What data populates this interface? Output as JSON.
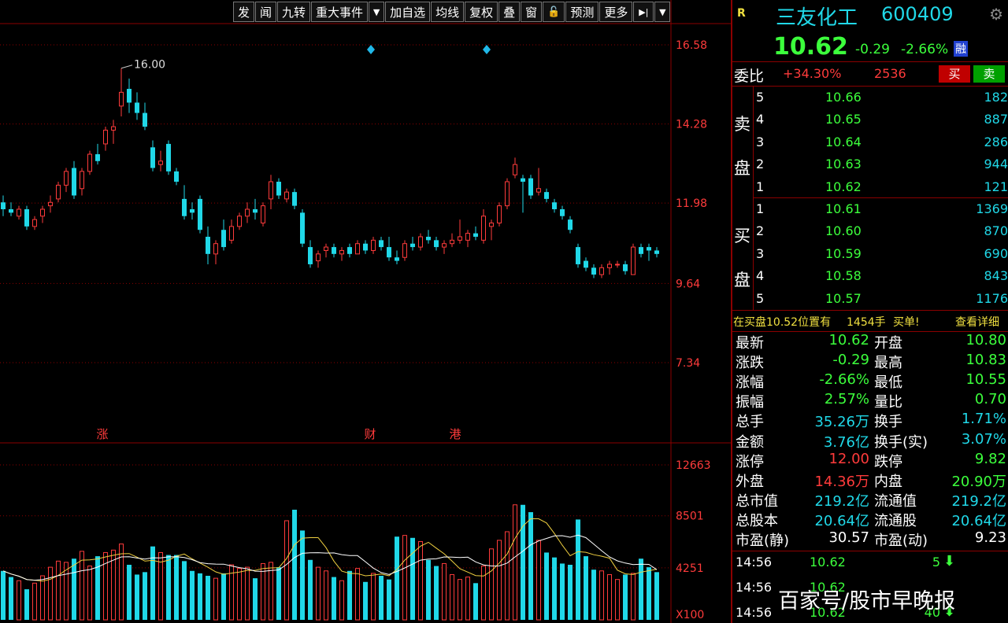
{
  "toolbar": {
    "buttons": [
      "发",
      "闻",
      "九转",
      "重大事件",
      "加自选",
      "均线",
      "复权",
      "叠",
      "窗",
      "预测",
      "更多"
    ]
  },
  "chart_data": {
    "type": "candlestick",
    "price_ticks": [
      "16.58",
      "14.28",
      "11.98",
      "9.64",
      "7.34"
    ],
    "volume_ticks": [
      "12663",
      "8501",
      "4251",
      "X100"
    ],
    "max_label": "16.00",
    "event_markers": [
      "涨",
      "财",
      "港"
    ],
    "colors": {
      "up": "#ff3b3b",
      "down": "#20d8e8",
      "grid": "#8b0000"
    },
    "candles": [
      [
        12.0,
        12.2,
        11.6,
        11.8
      ],
      [
        11.8,
        12.0,
        11.6,
        11.7
      ],
      [
        11.6,
        11.9,
        11.5,
        11.8
      ],
      [
        11.8,
        11.9,
        11.2,
        11.3
      ],
      [
        11.3,
        11.6,
        11.2,
        11.5
      ],
      [
        11.6,
        11.9,
        11.4,
        11.8
      ],
      [
        11.9,
        12.2,
        11.7,
        12.0
      ],
      [
        12.1,
        12.6,
        12.0,
        12.5
      ],
      [
        12.5,
        13.0,
        12.3,
        12.9
      ],
      [
        13.0,
        13.2,
        12.1,
        12.2
      ],
      [
        12.4,
        13.0,
        12.2,
        12.9
      ],
      [
        12.9,
        13.5,
        12.8,
        13.4
      ],
      [
        13.4,
        13.7,
        13.1,
        13.2
      ],
      [
        13.7,
        14.2,
        13.5,
        14.1
      ],
      [
        14.1,
        14.4,
        13.7,
        14.2
      ],
      [
        14.8,
        15.9,
        14.5,
        15.2
      ],
      [
        15.3,
        15.6,
        14.6,
        14.9
      ],
      [
        14.9,
        15.2,
        14.4,
        14.6
      ],
      [
        14.6,
        14.9,
        14.1,
        14.2
      ],
      [
        13.6,
        13.8,
        12.9,
        13.0
      ],
      [
        13.1,
        13.5,
        12.9,
        13.2
      ],
      [
        13.7,
        13.8,
        12.8,
        12.9
      ],
      [
        12.9,
        13.0,
        12.5,
        12.6
      ],
      [
        12.1,
        12.5,
        11.5,
        11.6
      ],
      [
        11.8,
        12.0,
        11.5,
        11.7
      ],
      [
        12.1,
        12.2,
        11.1,
        11.2
      ],
      [
        11.0,
        11.3,
        10.2,
        10.5
      ],
      [
        10.5,
        10.9,
        10.2,
        10.8
      ],
      [
        11.2,
        11.5,
        10.6,
        10.7
      ],
      [
        10.9,
        11.5,
        10.8,
        11.3
      ],
      [
        11.3,
        11.7,
        11.2,
        11.6
      ],
      [
        11.6,
        12.0,
        11.4,
        11.8
      ],
      [
        11.8,
        12.1,
        11.5,
        11.7
      ],
      [
        11.4,
        12.0,
        11.3,
        11.9
      ],
      [
        12.1,
        12.8,
        11.8,
        12.6
      ],
      [
        12.6,
        12.7,
        12.1,
        12.2
      ],
      [
        12.1,
        12.4,
        12.0,
        12.3
      ],
      [
        12.3,
        12.4,
        11.8,
        11.9
      ],
      [
        11.7,
        11.8,
        10.7,
        10.8
      ],
      [
        10.7,
        10.9,
        10.1,
        10.2
      ],
      [
        10.3,
        10.6,
        10.1,
        10.5
      ],
      [
        10.6,
        10.8,
        10.4,
        10.7
      ],
      [
        10.7,
        10.8,
        10.4,
        10.5
      ],
      [
        10.5,
        10.7,
        10.3,
        10.6
      ],
      [
        10.7,
        10.8,
        10.4,
        10.5
      ],
      [
        10.5,
        10.9,
        10.5,
        10.8
      ],
      [
        10.8,
        10.9,
        10.5,
        10.6
      ],
      [
        10.6,
        11.0,
        10.5,
        10.9
      ],
      [
        10.9,
        11.0,
        10.6,
        10.7
      ],
      [
        10.7,
        11.0,
        10.3,
        10.4
      ],
      [
        10.4,
        10.6,
        10.2,
        10.3
      ],
      [
        10.4,
        10.9,
        10.3,
        10.8
      ],
      [
        10.8,
        11.0,
        10.6,
        10.7
      ],
      [
        10.7,
        11.1,
        10.6,
        11.0
      ],
      [
        11.0,
        11.2,
        10.8,
        10.9
      ],
      [
        10.9,
        11.0,
        10.6,
        10.7
      ],
      [
        10.7,
        10.9,
        10.5,
        10.8
      ],
      [
        10.8,
        11.1,
        10.7,
        10.9
      ],
      [
        10.9,
        11.5,
        10.8,
        11.0
      ],
      [
        10.9,
        11.2,
        10.7,
        11.1
      ],
      [
        11.1,
        11.3,
        10.9,
        11.0
      ],
      [
        10.9,
        11.8,
        10.8,
        11.6
      ],
      [
        11.3,
        11.5,
        10.9,
        11.4
      ],
      [
        11.4,
        12.0,
        11.3,
        11.9
      ],
      [
        11.9,
        12.7,
        11.8,
        12.6
      ],
      [
        12.8,
        13.3,
        12.7,
        13.1
      ],
      [
        12.7,
        12.8,
        11.7,
        12.6
      ],
      [
        12.7,
        12.8,
        12.1,
        12.2
      ],
      [
        12.3,
        13.0,
        12.2,
        12.4
      ],
      [
        12.3,
        12.4,
        12.0,
        12.1
      ],
      [
        12.0,
        12.1,
        11.7,
        11.8
      ],
      [
        11.8,
        11.9,
        11.5,
        11.6
      ],
      [
        11.5,
        11.6,
        11.1,
        11.2
      ],
      [
        10.7,
        10.8,
        10.1,
        10.2
      ],
      [
        10.3,
        10.4,
        10.0,
        10.1
      ],
      [
        10.1,
        10.2,
        9.8,
        9.9
      ],
      [
        9.9,
        10.2,
        9.8,
        10.1
      ],
      [
        10.1,
        10.3,
        9.9,
        10.2
      ],
      [
        10.2,
        10.3,
        10.1,
        10.2
      ],
      [
        10.2,
        10.3,
        9.9,
        10.0
      ],
      [
        9.9,
        10.8,
        9.9,
        10.7
      ],
      [
        10.7,
        10.8,
        10.4,
        10.5
      ],
      [
        10.7,
        10.8,
        10.3,
        10.6
      ],
      [
        10.6,
        10.7,
        10.4,
        10.5
      ]
    ],
    "volume_hundred_shares": [
      4000,
      3500,
      3200,
      2500,
      3000,
      3600,
      4300,
      4800,
      4700,
      5000,
      5600,
      4400,
      5200,
      5500,
      5700,
      6200,
      4500,
      3700,
      3900,
      6000,
      5500,
      5300,
      5300,
      4800,
      4000,
      3800,
      3600,
      3400,
      3800,
      4500,
      4200,
      4300,
      3400,
      4600,
      4700,
      4300,
      8100,
      9000,
      7300,
      4900,
      4300,
      4000,
      3500,
      3200,
      4000,
      4200,
      3100,
      3800,
      3600,
      3300,
      6800,
      6900,
      6700,
      6400,
      4900,
      4400,
      4600,
      3700,
      3300,
      3500,
      3000,
      4400,
      5800,
      6500,
      7200,
      9400,
      9400,
      8800,
      6500,
      5500,
      5100,
      4600,
      4500,
      8200,
      5200,
      4100,
      4000,
      3700,
      3300,
      3700,
      3800,
      5000,
      4300,
      3900
    ]
  },
  "quote": {
    "flag": "R",
    "name": "三友化工",
    "code": "600409",
    "price": "10.62",
    "change": "-0.29",
    "change_pct": "-2.66%",
    "badge": "融"
  },
  "orderbook": {
    "ratio_label": "委比",
    "ratio": "+34.30%",
    "diff": "2536",
    "buy_btn": "买",
    "sell_btn": "卖",
    "sell_label": [
      "卖",
      "盘"
    ],
    "buy_label": [
      "买",
      "盘"
    ],
    "asks": [
      {
        "level": "5",
        "price": "10.66",
        "vol": "182"
      },
      {
        "level": "4",
        "price": "10.65",
        "vol": "887"
      },
      {
        "level": "3",
        "price": "10.64",
        "vol": "286"
      },
      {
        "level": "2",
        "price": "10.63",
        "vol": "944"
      },
      {
        "level": "1",
        "price": "10.62",
        "vol": "121"
      }
    ],
    "bids": [
      {
        "level": "1",
        "price": "10.61",
        "vol": "1369"
      },
      {
        "level": "2",
        "price": "10.60",
        "vol": "870"
      },
      {
        "level": "3",
        "price": "10.59",
        "vol": "690"
      },
      {
        "level": "4",
        "price": "10.58",
        "vol": "843"
      },
      {
        "level": "5",
        "price": "10.57",
        "vol": "1176"
      }
    ],
    "alert_text": "在买盘10.52位置有",
    "alert_vol": "1454手",
    "alert_tag": "买单!",
    "alert_link": "查看详细"
  },
  "stats": [
    {
      "l": "最新",
      "lv": "10.62",
      "lc": "green",
      "r": "开盘",
      "rv": "10.80",
      "rc": "green"
    },
    {
      "l": "涨跌",
      "lv": "-0.29",
      "lc": "green",
      "r": "最高",
      "rv": "10.83",
      "rc": "green"
    },
    {
      "l": "涨幅",
      "lv": "-2.66%",
      "lc": "green",
      "r": "最低",
      "rv": "10.55",
      "rc": "green"
    },
    {
      "l": "振幅",
      "lv": "2.57%",
      "lc": "green",
      "r": "量比",
      "rv": "0.70",
      "rc": "green"
    },
    {
      "l": "总手",
      "lv": "35.26万",
      "lc": "cyan",
      "r": "换手",
      "rv": "1.71%",
      "rc": "cyan"
    },
    {
      "l": "金额",
      "lv": "3.76亿",
      "lc": "cyan",
      "r": "换手(实)",
      "rv": "3.07%",
      "rc": "cyan"
    },
    {
      "l": "涨停",
      "lv": "12.00",
      "lc": "red",
      "r": "跌停",
      "rv": "9.82",
      "rc": "green"
    },
    {
      "l": "外盘",
      "lv": "14.36万",
      "lc": "red",
      "r": "内盘",
      "rv": "20.90万",
      "rc": "green"
    },
    {
      "l": "总市值",
      "lv": "219.2亿",
      "lc": "cyan",
      "r": "流通值",
      "rv": "219.2亿",
      "rc": "cyan"
    },
    {
      "l": "总股本",
      "lv": "20.64亿",
      "lc": "cyan",
      "r": "流通股",
      "rv": "20.64亿",
      "rc": "cyan"
    },
    {
      "l": "市盈(静)",
      "lv": "30.57",
      "lc": "white",
      "r": "市盈(动)",
      "rv": "9.23",
      "rc": "white"
    }
  ],
  "ticks": [
    {
      "time": "14:56",
      "price": "10.62",
      "vol": "5",
      "dir": "down"
    },
    {
      "time": "14:56",
      "price": "10.62",
      "vol": "",
      "dir": ""
    },
    {
      "time": "14:56",
      "price": "10.62",
      "vol": "40",
      "dir": "down"
    }
  ],
  "watermark": "百家号/股市早晚报"
}
